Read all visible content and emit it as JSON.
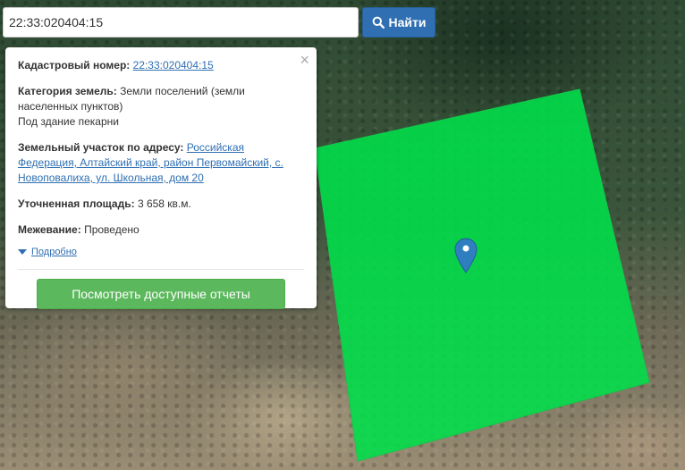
{
  "search": {
    "value": "22:33:020404:15",
    "button_label": "Найти",
    "button_icon": "search-icon",
    "button_color": "#2f6fb2"
  },
  "map": {
    "parcel_color": "#00e04a",
    "marker_color": "#2f7fc0"
  },
  "popup": {
    "close_label": "×",
    "cadastral": {
      "label": "Кадастровый номер:",
      "value": "22:33:020404:15"
    },
    "category": {
      "label": "Категория земель:",
      "value_line1": "Земли поселений (земли",
      "value_line2": "населенных пунктов)",
      "purpose": "Под здание пекарни"
    },
    "address": {
      "label": "Земельный участок по адресу:",
      "value_line1": "Российская",
      "value_line2": "Федерация, Алтайский край, район Первомайский, с.",
      "value_line3": "Новоповалиха, ул. Школьная, дом 20"
    },
    "area": {
      "label": "Уточненная площадь:",
      "value": "3 658 кв.м."
    },
    "survey": {
      "label": "Межевание:",
      "value": "Проведено"
    },
    "details_link": "Подробно",
    "report_button": "Посмотреть доступные отчеты",
    "report_button_color": "#5cb85c"
  }
}
